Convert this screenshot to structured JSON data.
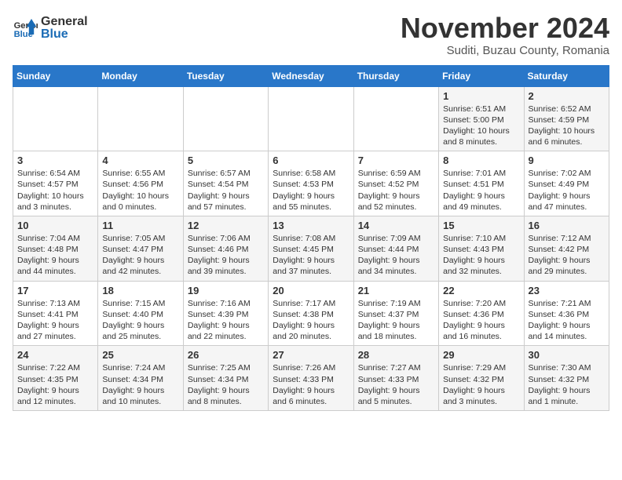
{
  "logo": {
    "general": "General",
    "blue": "Blue"
  },
  "title": "November 2024",
  "subtitle": "Suditi, Buzau County, Romania",
  "days_of_week": [
    "Sunday",
    "Monday",
    "Tuesday",
    "Wednesday",
    "Thursday",
    "Friday",
    "Saturday"
  ],
  "weeks": [
    [
      {
        "day": "",
        "info": ""
      },
      {
        "day": "",
        "info": ""
      },
      {
        "day": "",
        "info": ""
      },
      {
        "day": "",
        "info": ""
      },
      {
        "day": "",
        "info": ""
      },
      {
        "day": "1",
        "info": "Sunrise: 6:51 AM\nSunset: 5:00 PM\nDaylight: 10 hours and 8 minutes."
      },
      {
        "day": "2",
        "info": "Sunrise: 6:52 AM\nSunset: 4:59 PM\nDaylight: 10 hours and 6 minutes."
      }
    ],
    [
      {
        "day": "3",
        "info": "Sunrise: 6:54 AM\nSunset: 4:57 PM\nDaylight: 10 hours and 3 minutes."
      },
      {
        "day": "4",
        "info": "Sunrise: 6:55 AM\nSunset: 4:56 PM\nDaylight: 10 hours and 0 minutes."
      },
      {
        "day": "5",
        "info": "Sunrise: 6:57 AM\nSunset: 4:54 PM\nDaylight: 9 hours and 57 minutes."
      },
      {
        "day": "6",
        "info": "Sunrise: 6:58 AM\nSunset: 4:53 PM\nDaylight: 9 hours and 55 minutes."
      },
      {
        "day": "7",
        "info": "Sunrise: 6:59 AM\nSunset: 4:52 PM\nDaylight: 9 hours and 52 minutes."
      },
      {
        "day": "8",
        "info": "Sunrise: 7:01 AM\nSunset: 4:51 PM\nDaylight: 9 hours and 49 minutes."
      },
      {
        "day": "9",
        "info": "Sunrise: 7:02 AM\nSunset: 4:49 PM\nDaylight: 9 hours and 47 minutes."
      }
    ],
    [
      {
        "day": "10",
        "info": "Sunrise: 7:04 AM\nSunset: 4:48 PM\nDaylight: 9 hours and 44 minutes."
      },
      {
        "day": "11",
        "info": "Sunrise: 7:05 AM\nSunset: 4:47 PM\nDaylight: 9 hours and 42 minutes."
      },
      {
        "day": "12",
        "info": "Sunrise: 7:06 AM\nSunset: 4:46 PM\nDaylight: 9 hours and 39 minutes."
      },
      {
        "day": "13",
        "info": "Sunrise: 7:08 AM\nSunset: 4:45 PM\nDaylight: 9 hours and 37 minutes."
      },
      {
        "day": "14",
        "info": "Sunrise: 7:09 AM\nSunset: 4:44 PM\nDaylight: 9 hours and 34 minutes."
      },
      {
        "day": "15",
        "info": "Sunrise: 7:10 AM\nSunset: 4:43 PM\nDaylight: 9 hours and 32 minutes."
      },
      {
        "day": "16",
        "info": "Sunrise: 7:12 AM\nSunset: 4:42 PM\nDaylight: 9 hours and 29 minutes."
      }
    ],
    [
      {
        "day": "17",
        "info": "Sunrise: 7:13 AM\nSunset: 4:41 PM\nDaylight: 9 hours and 27 minutes."
      },
      {
        "day": "18",
        "info": "Sunrise: 7:15 AM\nSunset: 4:40 PM\nDaylight: 9 hours and 25 minutes."
      },
      {
        "day": "19",
        "info": "Sunrise: 7:16 AM\nSunset: 4:39 PM\nDaylight: 9 hours and 22 minutes."
      },
      {
        "day": "20",
        "info": "Sunrise: 7:17 AM\nSunset: 4:38 PM\nDaylight: 9 hours and 20 minutes."
      },
      {
        "day": "21",
        "info": "Sunrise: 7:19 AM\nSunset: 4:37 PM\nDaylight: 9 hours and 18 minutes."
      },
      {
        "day": "22",
        "info": "Sunrise: 7:20 AM\nSunset: 4:36 PM\nDaylight: 9 hours and 16 minutes."
      },
      {
        "day": "23",
        "info": "Sunrise: 7:21 AM\nSunset: 4:36 PM\nDaylight: 9 hours and 14 minutes."
      }
    ],
    [
      {
        "day": "24",
        "info": "Sunrise: 7:22 AM\nSunset: 4:35 PM\nDaylight: 9 hours and 12 minutes."
      },
      {
        "day": "25",
        "info": "Sunrise: 7:24 AM\nSunset: 4:34 PM\nDaylight: 9 hours and 10 minutes."
      },
      {
        "day": "26",
        "info": "Sunrise: 7:25 AM\nSunset: 4:34 PM\nDaylight: 9 hours and 8 minutes."
      },
      {
        "day": "27",
        "info": "Sunrise: 7:26 AM\nSunset: 4:33 PM\nDaylight: 9 hours and 6 minutes."
      },
      {
        "day": "28",
        "info": "Sunrise: 7:27 AM\nSunset: 4:33 PM\nDaylight: 9 hours and 5 minutes."
      },
      {
        "day": "29",
        "info": "Sunrise: 7:29 AM\nSunset: 4:32 PM\nDaylight: 9 hours and 3 minutes."
      },
      {
        "day": "30",
        "info": "Sunrise: 7:30 AM\nSunset: 4:32 PM\nDaylight: 9 hours and 1 minute."
      }
    ]
  ]
}
